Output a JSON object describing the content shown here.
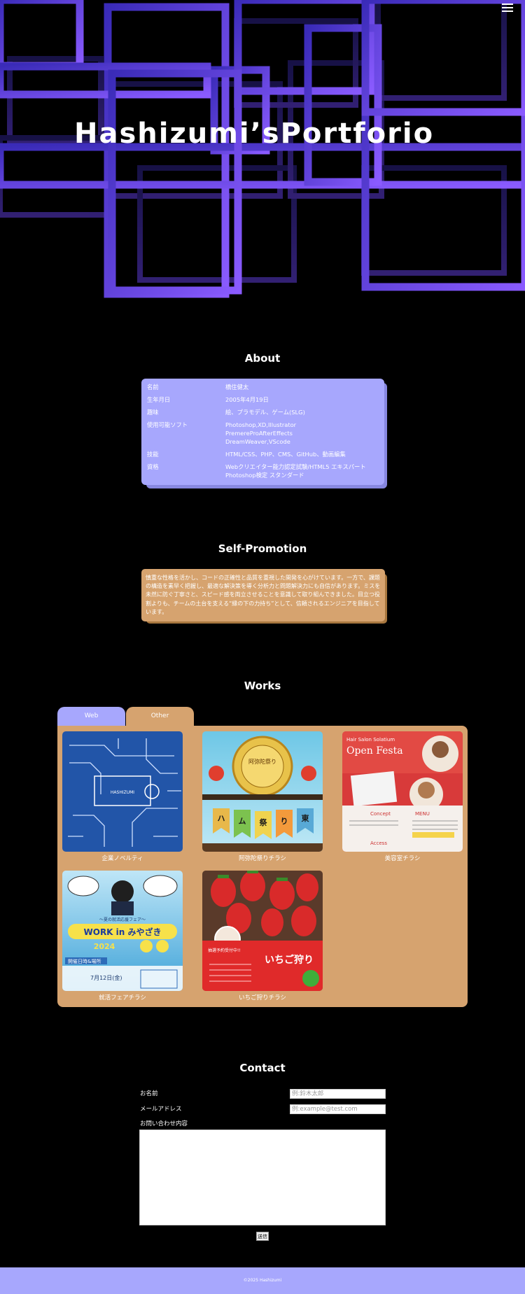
{
  "hero": {
    "title": "Hashizumi’sPortforio",
    "menu_icon": "hamburger-menu-icon",
    "accent": "#7b4dff"
  },
  "about": {
    "title": "About",
    "rows": [
      {
        "label": "名前",
        "lines": [
          "橋住健太"
        ]
      },
      {
        "label": "生年月日",
        "lines": [
          "2005年4月19日"
        ]
      },
      {
        "label": "趣味",
        "lines": [
          "絵、プラモデル、ゲーム(SLG)"
        ]
      },
      {
        "label": "使用可能ソフト",
        "lines": [
          "Photoshop,XD,Illustrator",
          "PremereProAfterEffects",
          "DreamWeaver,VScode"
        ]
      },
      {
        "label": "技能",
        "lines": [
          "HTML/CSS、PHP、CMS、GitHub、動画編集"
        ]
      },
      {
        "label": "資格",
        "lines": [
          "Webクリエイター能力認定試験/HTML5 エキスパート",
          "Photoshop検定 スタンダード"
        ]
      }
    ]
  },
  "promotion": {
    "title": "Self-Promotion",
    "text": "慎重な性格を活かし、コードの正確性と品質を重視した開発を心がけています。一方で、課題の構造を素早く把握し、最適な解決策を導く分析力と問題解決力にも自信があります。ミスを未然に防ぐ丁寧さと、スピード感を両立させることを意識して取り組んできました。目立つ役割よりも、チームの土台を支える“縁の下の力持ち”として、信頼されるエンジニアを目指しています。"
  },
  "works": {
    "title": "Works",
    "tabs": [
      "Web",
      "Other"
    ],
    "active_tab": "Other",
    "items": [
      {
        "caption": "企業ノベルティ",
        "icon": "circuit-board-design-image"
      },
      {
        "caption": "阿弥陀祭りチラシ",
        "icon": "festival-flyer-image"
      },
      {
        "caption": "美容室チラシ",
        "icon": "hair-salon-flyer-image"
      },
      {
        "caption": "就活フェアチラシ",
        "icon": "job-fair-flyer-image"
      },
      {
        "caption": "いちご狩りチラシ",
        "icon": "strawberry-picking-flyer-image"
      }
    ],
    "thumb_text": {
      "novelty_logo": "HASHIZUMI",
      "festival_top": "阿弥陀祭り",
      "festival_flags": [
        "ハ",
        "ム",
        "祭",
        "り",
        "東"
      ],
      "salon_small": "Hair Salon Solatium",
      "salon_big": "Open Festa",
      "salon_concept": "Concept",
      "salon_menu": "MENU",
      "salon_access": "Access",
      "jobfair_top": "〜夏の就活応援フェア〜",
      "jobfair_big": "WORK in みやざき",
      "jobfair_year": "2024",
      "jobfair_date_label": "開催日時&場所",
      "jobfair_date": "7月12日(金)",
      "strawberry_big": "いちご狩り",
      "strawberry_sub": "抽選予約受付中!!"
    }
  },
  "contact": {
    "title": "Contact",
    "name_label": "お名前",
    "name_placeholder": "例:鈴木太郎",
    "email_label": "メールアドレス",
    "email_placeholder": "例:example@test.com",
    "message_label": "お問い合わせ内容",
    "submit_label": "送信"
  },
  "footer": {
    "copyright": "©2025 Hashizumi"
  },
  "colors": {
    "purple": "#a7a7fd",
    "tan": "#d6a36f",
    "background": "#000000"
  }
}
